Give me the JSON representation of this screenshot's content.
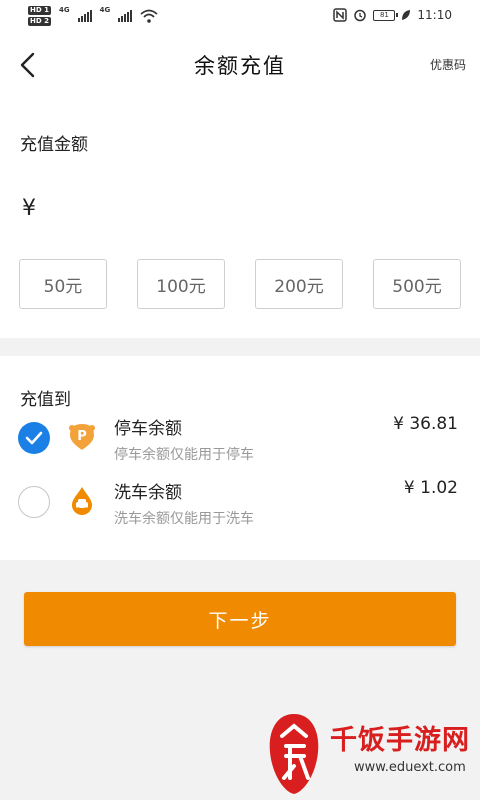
{
  "status_bar": {
    "hd1": "HD 1",
    "hd2": "HD 2",
    "net1": "4G",
    "net2": "4G",
    "battery": "81",
    "time": "11:10",
    "icons": [
      "nfc-icon",
      "alarm-icon",
      "battery-icon",
      "leaf-icon",
      "wifi-icon"
    ]
  },
  "nav": {
    "back_icon": "chevron-left-icon",
    "title": "余额充值",
    "coupon": "优惠码"
  },
  "amount": {
    "label": "充值金额",
    "currency": "¥",
    "input_value": "",
    "chips": [
      "50元",
      "100元",
      "200元",
      "500元"
    ]
  },
  "target": {
    "label": "充值到",
    "options": [
      {
        "name": "停车余额",
        "desc": "停车余额仅能用于停车",
        "amount": "¥ 36.81",
        "selected": true,
        "icon": "parking-icon"
      },
      {
        "name": "洗车余额",
        "desc": "洗车余额仅能用于洗车",
        "amount": "¥ 1.02",
        "selected": false,
        "icon": "car-wash-icon"
      }
    ]
  },
  "next_button": "下一步",
  "watermark": {
    "title": "千饭手游网",
    "url": "www.eduext.com",
    "badge_icon": "fan-logo-icon"
  },
  "colors": {
    "accent_orange": "#f08a00",
    "selected_blue": "#1a80e6",
    "watermark_red": "#d81e1e"
  }
}
